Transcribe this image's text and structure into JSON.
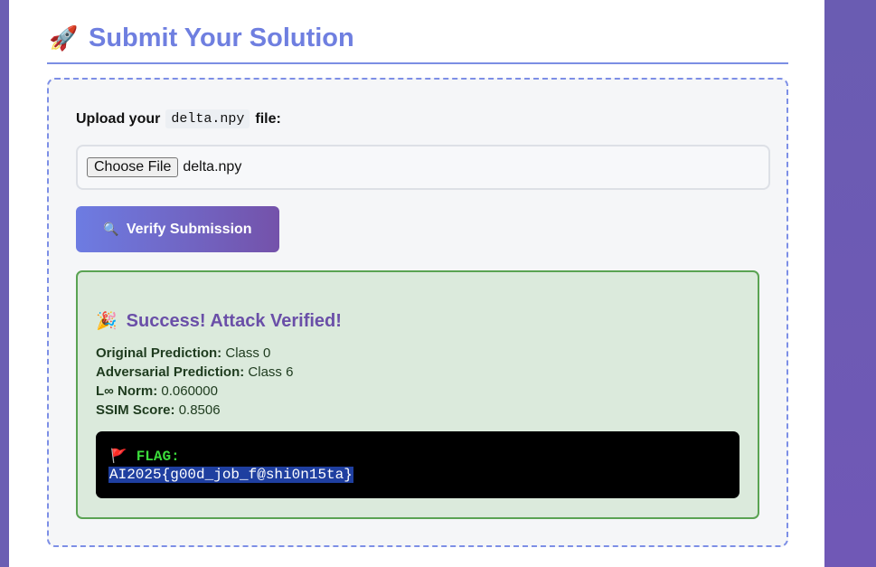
{
  "section": {
    "icon": "rocket-icon",
    "title": "Submit Your Solution"
  },
  "upload": {
    "label_prefix": "Upload your",
    "filename_code": "delta.npy",
    "label_suffix": "file:",
    "choose_button": "Choose File",
    "selected_file": "delta.npy"
  },
  "verify": {
    "icon": "magnifier-icon",
    "label": "Verify Submission"
  },
  "result": {
    "icon": "party-popper-icon",
    "title": "Success! Attack Verified!",
    "items": [
      {
        "label": "Original Prediction:",
        "value": "Class 0"
      },
      {
        "label": "Adversarial Prediction:",
        "value": "Class 6"
      },
      {
        "label": "L∞ Norm:",
        "value": "0.060000"
      },
      {
        "label": "SSIM Score:",
        "value": "0.8506"
      }
    ],
    "flag": {
      "icon": "red-flag-icon",
      "label": "FLAG:",
      "value": "AI2025{g00d_job_f@shi0n15ta}"
    }
  },
  "colors": {
    "accent": "#6f7fe0",
    "success_border": "#5aa353",
    "success_bg": "#dbeadc",
    "background": "#6c5cb8"
  }
}
